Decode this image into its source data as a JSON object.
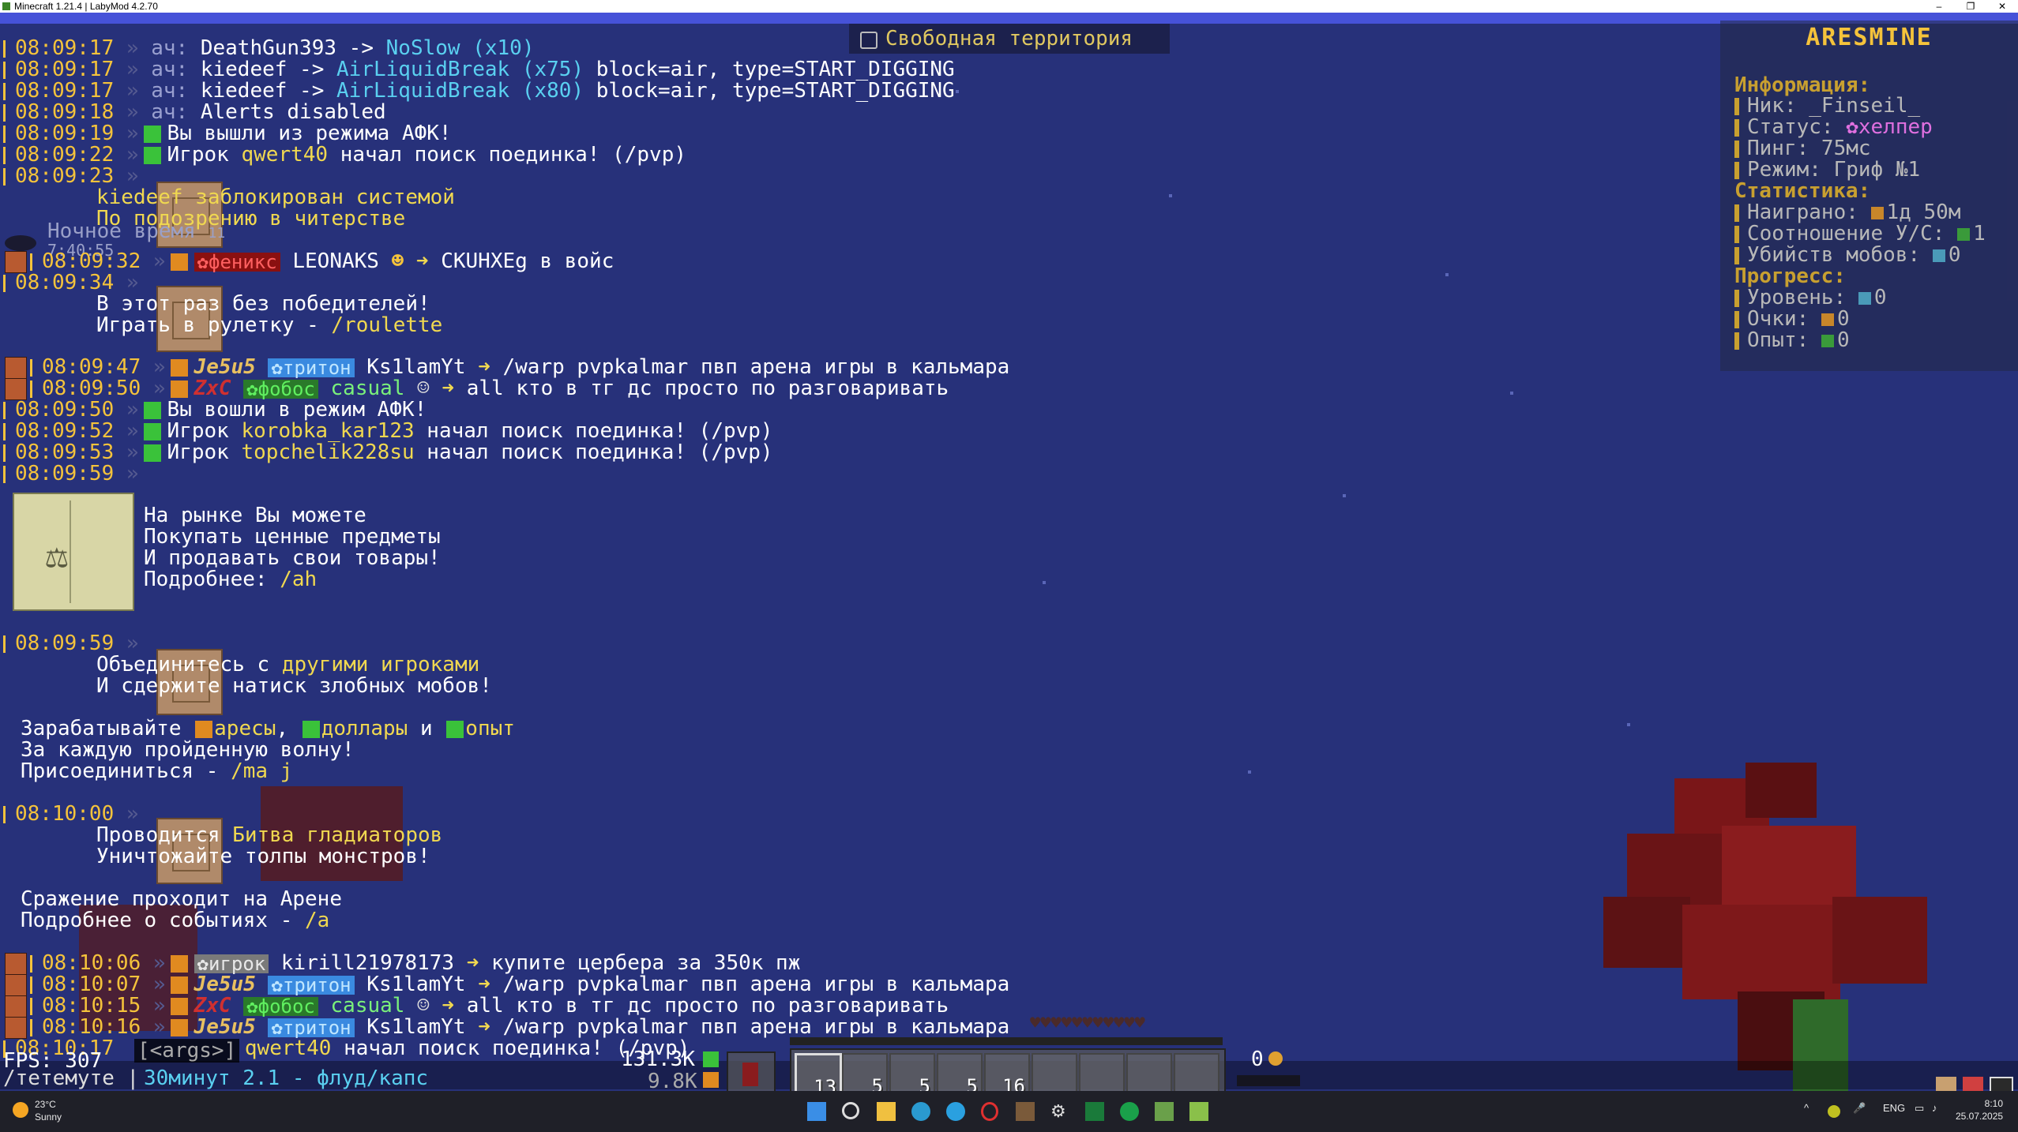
{
  "window": {
    "title": "Minecraft 1.21.4 | LabyMod 4.2.70"
  },
  "region": {
    "name": "Свободная территория"
  },
  "scoreboard": {
    "logo": "ARESMINE",
    "info_header": "Информация:",
    "nick": "Ник: _Finseil_",
    "status_label": "Статус:",
    "status_value": "✿хелпер",
    "ping": "Пинг: 75мс",
    "mode": "Режим: Гриф №1",
    "stats_header": "Статистика:",
    "played_label": "Наиграно:",
    "played_value": "1д 50м",
    "ratio_label": "Соотношение У/С:",
    "ratio_value": "1",
    "mobs_label": "Убийств мобов:",
    "mobs_value": "0",
    "progress_header": "Прогресс:",
    "level_label": "Уровень:",
    "level_value": "0",
    "points_label": "Очки:",
    "points_value": "0",
    "exp_label": "Опыт:",
    "exp_value": "0"
  },
  "chat": {
    "l1_ts": "08:09:17",
    "l1_pre": "ач:",
    "l1_name": "DeathGun393 ->",
    "l1_check": "NoSlow (x10)",
    "l2_ts": "08:09:17",
    "l2_pre": "ач:",
    "l2_name": "kiedeef ->",
    "l2_check": "AirLiquidBreak (x75)",
    "l2_rest": "block=air, type=START_DIGGING",
    "l3_ts": "08:09:17",
    "l3_pre": "ач:",
    "l3_name": "kiedeef ->",
    "l3_check": "AirLiquidBreak (x80)",
    "l3_rest": "block=air, type=START_DIGGING",
    "l4_ts": "08:09:18",
    "l4_pre": "ач:",
    "l4_text": "Alerts disabled",
    "l5_ts": "08:09:19",
    "l5_text": "Вы вышли из режима АФК!",
    "l6_ts": "08:09:22",
    "l6_a": "Игрок",
    "l6_name": "qwert40",
    "l6_b": "начал поиск поединка! (/pvp)",
    "l7_ts": "08:09:23",
    "l8_a": "kiedeef",
    "l8_b": "заблокирован системой",
    "l9_text": "По подозрению в читерстве",
    "ov_night": "Ночное время",
    "ov_night2": "11",
    "ov_clock": "7:40:55",
    "l10_ts": "08:09:32",
    "l10_badge": "✿феникс",
    "l10_name": "LEONAKS",
    "l10_to": "CKUHXEg в войс",
    "l11_ts": "08:09:34",
    "l12_text": "В этот раз без победителей!",
    "l13_a": "Играть в рулетку - ",
    "l13_cmd": "/roulette",
    "l14_ts": "08:09:47",
    "l14_nick": "Je5u5",
    "l14_badge": "✿тритон",
    "l14_to": "Ks1lamYt",
    "l14_msg": "/warp pvpkalmar пвп арена игры в кальмара",
    "l15_ts": "08:09:50",
    "l15_nick": "ZxC",
    "l15_badge": "✿фобос",
    "l15_to": "casual",
    "l15_msg": "all кто в тг дс просто по разговаривать",
    "l16_ts": "08:09:50",
    "l16_text": "Вы вошли в режим АФК!",
    "l17_ts": "08:09:52",
    "l17_a": "Игрок",
    "l17_name": "korobka_kar123",
    "l17_b": "начал поиск поединка! (/pvp)",
    "l18_ts": "08:09:53",
    "l18_a": "Игрок",
    "l18_name": "topchelik228su",
    "l18_b": "начал поиск поединка! (/pvp)",
    "l19_ts": "08:09:59",
    "m1": "На рынке Вы можете",
    "m2": "Покупать ценные предметы",
    "m3": "И продавать свои товары!",
    "m4_a": "Подробнее: ",
    "m4_cmd": "/ah",
    "l20_ts": "08:09:59",
    "n1_a": "Объединитесь с ",
    "n1_b": "другими игроками",
    "n2": "И сдержите натиск злобных мобов!",
    "n3_a": "Зарабатывайте ",
    "n3_b": "аресы",
    "n3_c": ", ",
    "n3_d": "доллары",
    "n3_e": " и ",
    "n3_f": "опыт",
    "n4": "За каждую пройденную волну!",
    "n5_a": "Присоединиться - ",
    "n5_cmd": "/ma j",
    "l21_ts": "08:10:00",
    "g1_a": "Проводится ",
    "g1_b": "Битва гладиаторов",
    "g2": "Уничтожайте толпы монстров!",
    "g3": "Сражение проходит на Арене",
    "g4_a": "Подробнее о событиях - ",
    "g4_cmd": "/a",
    "l22_ts": "08:10:06",
    "l22_badge": "✿игрок",
    "l22_name": "kirill21978173",
    "l22_msg": "купите цербера за 350к пж",
    "l23_ts": "08:10:07",
    "l23_nick": "Je5u5",
    "l23_badge": "✿тритон",
    "l23_to": "Ks1lamYt",
    "l23_msg": "/warp pvpkalmar пвп арена игры в кальмара",
    "l24_ts": "08:10:15",
    "l24_nick": "ZxC",
    "l24_badge": "✿фобос",
    "l24_to": "casual",
    "l24_msg": "all кто в тг дс просто по разговаривать",
    "l25_ts": "08:10:16",
    "l25_nick": "Je5u5",
    "l25_badge": "✿тритон",
    "l25_to": "Ks1lamYt",
    "l25_msg": "/warp pvpkalmar пвп арена игры в кальмара",
    "l26_ts": "08:10:17",
    "l26_name": "qwert40",
    "l26_b": "начал поиск поединка! (/pvp)"
  },
  "hud": {
    "fps": "FPS: 307",
    "command_suggest": "[<args>]",
    "chat_input_a": "/тетемуте |",
    "chat_input_b": "30минут 2.1 - флуд/капс",
    "money": "131.3K",
    "money2": "9.8K",
    "xp_level": "0",
    "hotbar": [
      "13",
      "5",
      "5",
      "5",
      "16",
      "",
      "",
      "",
      ""
    ]
  },
  "taskbar": {
    "temp": "23°C",
    "weather": "Sunny",
    "lang": "ENG",
    "time": "8:10",
    "date": "25.07.2025"
  }
}
